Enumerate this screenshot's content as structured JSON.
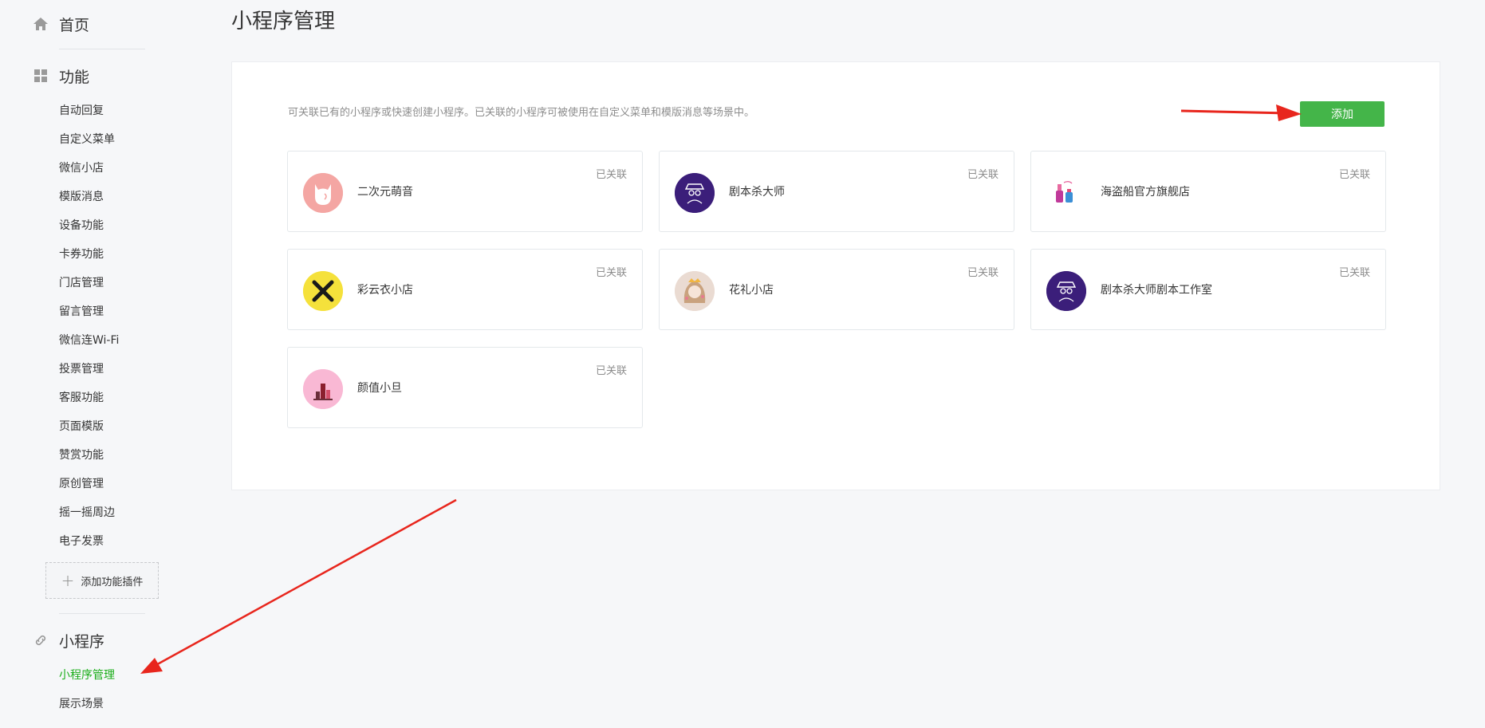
{
  "sidebar": {
    "home_label": "首页",
    "features_label": "功能",
    "feature_items": [
      "自动回复",
      "自定义菜单",
      "微信小店",
      "模版消息",
      "设备功能",
      "卡券功能",
      "门店管理",
      "留言管理",
      "微信连Wi-Fi",
      "投票管理",
      "客服功能",
      "页面模版",
      "赞赏功能",
      "原创管理",
      "摇一摇周边",
      "电子发票"
    ],
    "add_plugin_label": "添加功能插件",
    "miniprogram_label": "小程序",
    "miniprogram_items": [
      "小程序管理",
      "展示场景"
    ]
  },
  "main": {
    "title": "小程序管理",
    "description": "可关联已有的小程序或快速创建小程序。已关联的小程序可被使用在自定义菜单和模版消息等场景中。",
    "add_button": "添加",
    "cards": [
      {
        "name": "二次元萌音",
        "status": "已关联",
        "icon": "cat-avatar-icon"
      },
      {
        "name": "剧本杀大师",
        "status": "已关联",
        "icon": "detective-avatar-icon"
      },
      {
        "name": "海盗船官方旗舰店",
        "status": "已关联",
        "icon": "cosmetics-avatar-icon"
      },
      {
        "name": "彩云衣小店",
        "status": "已关联",
        "icon": "x-avatar-icon"
      },
      {
        "name": "花礼小店",
        "status": "已关联",
        "icon": "girl-avatar-icon"
      },
      {
        "name": "剧本杀大师剧本工作室",
        "status": "已关联",
        "icon": "detective-avatar-icon"
      },
      {
        "name": "颜值小旦",
        "status": "已关联",
        "icon": "makeup-avatar-icon"
      }
    ]
  },
  "colors": {
    "accent_green": "#44b549",
    "active_menu_green": "#1aad19",
    "arrow_red": "#e8261d"
  }
}
